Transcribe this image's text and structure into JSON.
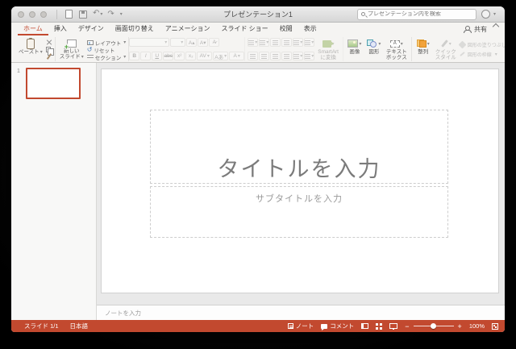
{
  "window": {
    "title": "プレゼンテーション1",
    "search_placeholder": "プレゼンテーション内を検索"
  },
  "tabs": [
    {
      "label": "ホーム",
      "active": true
    },
    {
      "label": "挿入",
      "active": false
    },
    {
      "label": "デザイン",
      "active": false
    },
    {
      "label": "画面切り替え",
      "active": false
    },
    {
      "label": "アニメーション",
      "active": false
    },
    {
      "label": "スライド ショー",
      "active": false
    },
    {
      "label": "校閲",
      "active": false
    },
    {
      "label": "表示",
      "active": false
    }
  ],
  "share": {
    "label": "共有"
  },
  "ribbon": {
    "paste": "ペースト",
    "new_slide_line1": "新しい",
    "new_slide_line2": "スライド",
    "layout": "レイアウト",
    "reset": "リセット",
    "section": "セクション",
    "bold": "B",
    "italic": "I",
    "underline": "U",
    "strikethrough": "abc",
    "superscript": "x²",
    "subscript": "x₂",
    "char_spacing": "AV",
    "change_case": "Aあ",
    "font_color": "A",
    "smartart_line1": "SmartArt",
    "smartart_line2": "に変換",
    "picture": "画像",
    "shapes": "図形",
    "textbox_line1": "テキスト",
    "textbox_line2": "ボックス",
    "arrange": "整列",
    "quick_line1": "クイック",
    "quick_line2": "スタイル",
    "shape_fill": "図形の塗りつぶし",
    "shape_outline": "図形の枠線"
  },
  "slide_panel": {
    "slide_number": "1"
  },
  "slide": {
    "title_placeholder": "タイトルを入力",
    "subtitle_placeholder": "サブタイトルを入力"
  },
  "notes": {
    "placeholder": "ノートを入力"
  },
  "status": {
    "slide_counter": "スライド 1/1",
    "language": "日本語",
    "notes_label": "ノート",
    "comments_label": "コメント",
    "zoom_level": "100%"
  },
  "colors": {
    "accent": "#C2492F",
    "titlebar": "#ECECEC",
    "ribbon_bg": "#F5F4F2",
    "canvas_bg": "#E9E9E9"
  }
}
